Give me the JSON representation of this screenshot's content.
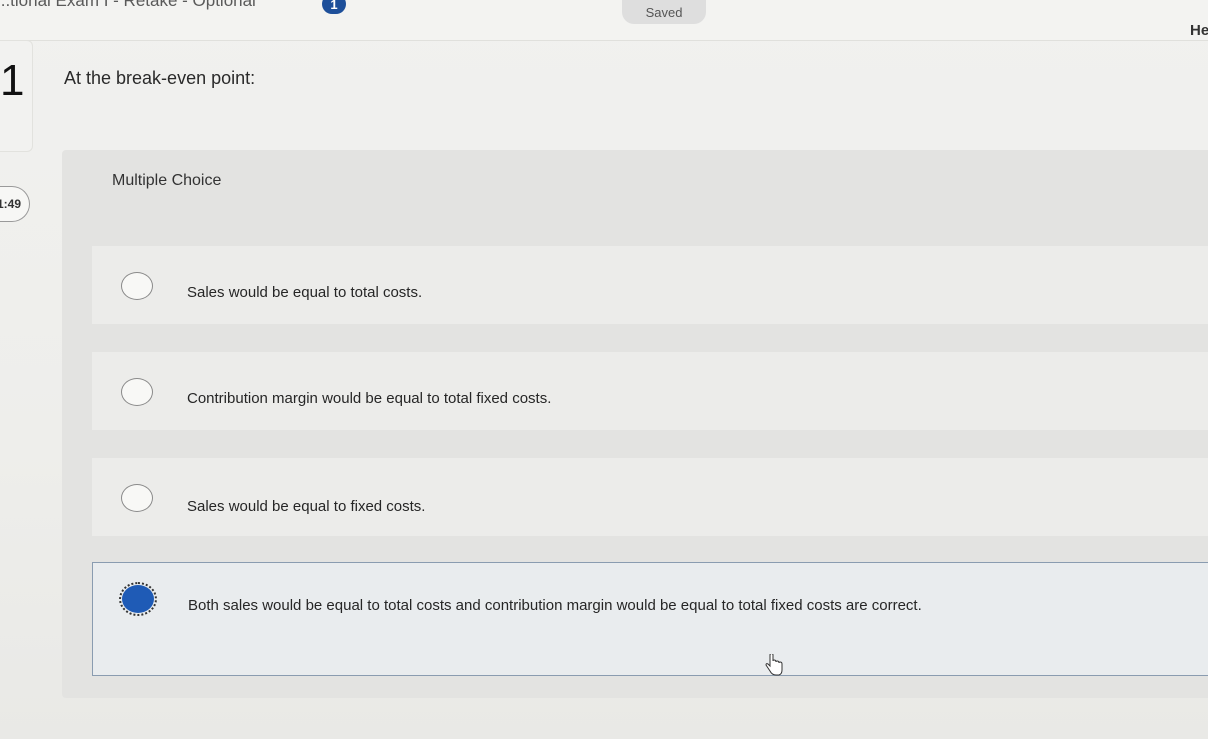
{
  "header": {
    "exam_title": "...tional Exam I - Retake - Optional",
    "info_badge": "1",
    "saved_status": "Saved",
    "help_label": "He"
  },
  "sidebar": {
    "question_number": "1",
    "timer": "1:49"
  },
  "question": {
    "prompt": "At the break-even point:",
    "type_label": "Multiple Choice",
    "options": [
      {
        "label": "Sales would be equal to total costs.",
        "selected": false
      },
      {
        "label": "Contribution margin would be equal to total fixed costs.",
        "selected": false
      },
      {
        "label": "Sales would be equal to fixed costs.",
        "selected": false
      },
      {
        "label": "Both sales would be equal to total costs and contribution margin would be equal to total fixed costs are correct.",
        "selected": true
      }
    ]
  },
  "colors": {
    "accent": "#1f5bb6",
    "panel_background": "#e3e3e1",
    "option_background": "#ececea"
  },
  "icons": {
    "info": "info-badge-icon",
    "cursor": "hand-pointer-icon"
  }
}
